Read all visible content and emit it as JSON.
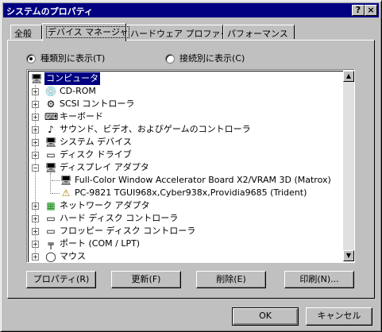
{
  "window": {
    "title": "システムのプロパティ",
    "help_label": "?",
    "close_label": "×"
  },
  "tabs": [
    {
      "label": "全般"
    },
    {
      "label": "デバイス マネージャ"
    },
    {
      "label": "ハードウェア プロファイル"
    },
    {
      "label": "パフォーマンス"
    }
  ],
  "view_options": {
    "by_type": "種類別に表示(T)",
    "by_connection": "接続別に表示(C)",
    "selected": "by_type"
  },
  "tree": {
    "root": "コンピュータ",
    "items": [
      {
        "label": "CD-ROM",
        "icon": "cdrom-icon"
      },
      {
        "label": "SCSI コントローラ",
        "icon": "scsi-icon"
      },
      {
        "label": "キーボード",
        "icon": "keyboard-icon"
      },
      {
        "label": "サウンド、ビデオ、およびゲームのコントローラ",
        "icon": "sound-icon"
      },
      {
        "label": "システム デバイス",
        "icon": "system-device-icon"
      },
      {
        "label": "ディスク ドライブ",
        "icon": "disk-drive-icon"
      },
      {
        "label": "ディスプレイ アダプタ",
        "icon": "display-adapter-icon",
        "expanded": true,
        "children": [
          {
            "label": "Full-Color Window Accelerator Board X2/VRAM 3D (Matrox)",
            "icon": "monitor-icon"
          },
          {
            "label": "PC-9821 TGUI968x,Cyber938x,Providia9685 (Trident)",
            "icon": "monitor-warning-icon"
          }
        ]
      },
      {
        "label": "ネットワーク アダプタ",
        "icon": "network-adapter-icon"
      },
      {
        "label": "ハード ディスク コントローラ",
        "icon": "hdd-controller-icon"
      },
      {
        "label": "フロッピー ディスク コントローラ",
        "icon": "floppy-controller-icon"
      },
      {
        "label": "ポート (COM / LPT)",
        "icon": "port-icon"
      },
      {
        "label": "マウス",
        "icon": "mouse-icon"
      }
    ]
  },
  "buttons": {
    "properties": "プロパティ(R)",
    "refresh": "更新(F)",
    "remove": "削除(E)",
    "print": "印刷(N)...",
    "ok": "OK",
    "cancel": "キャンセル"
  },
  "colors": {
    "titlebar": "#000080",
    "face": "#c0c0c0",
    "selection": "#000080"
  }
}
